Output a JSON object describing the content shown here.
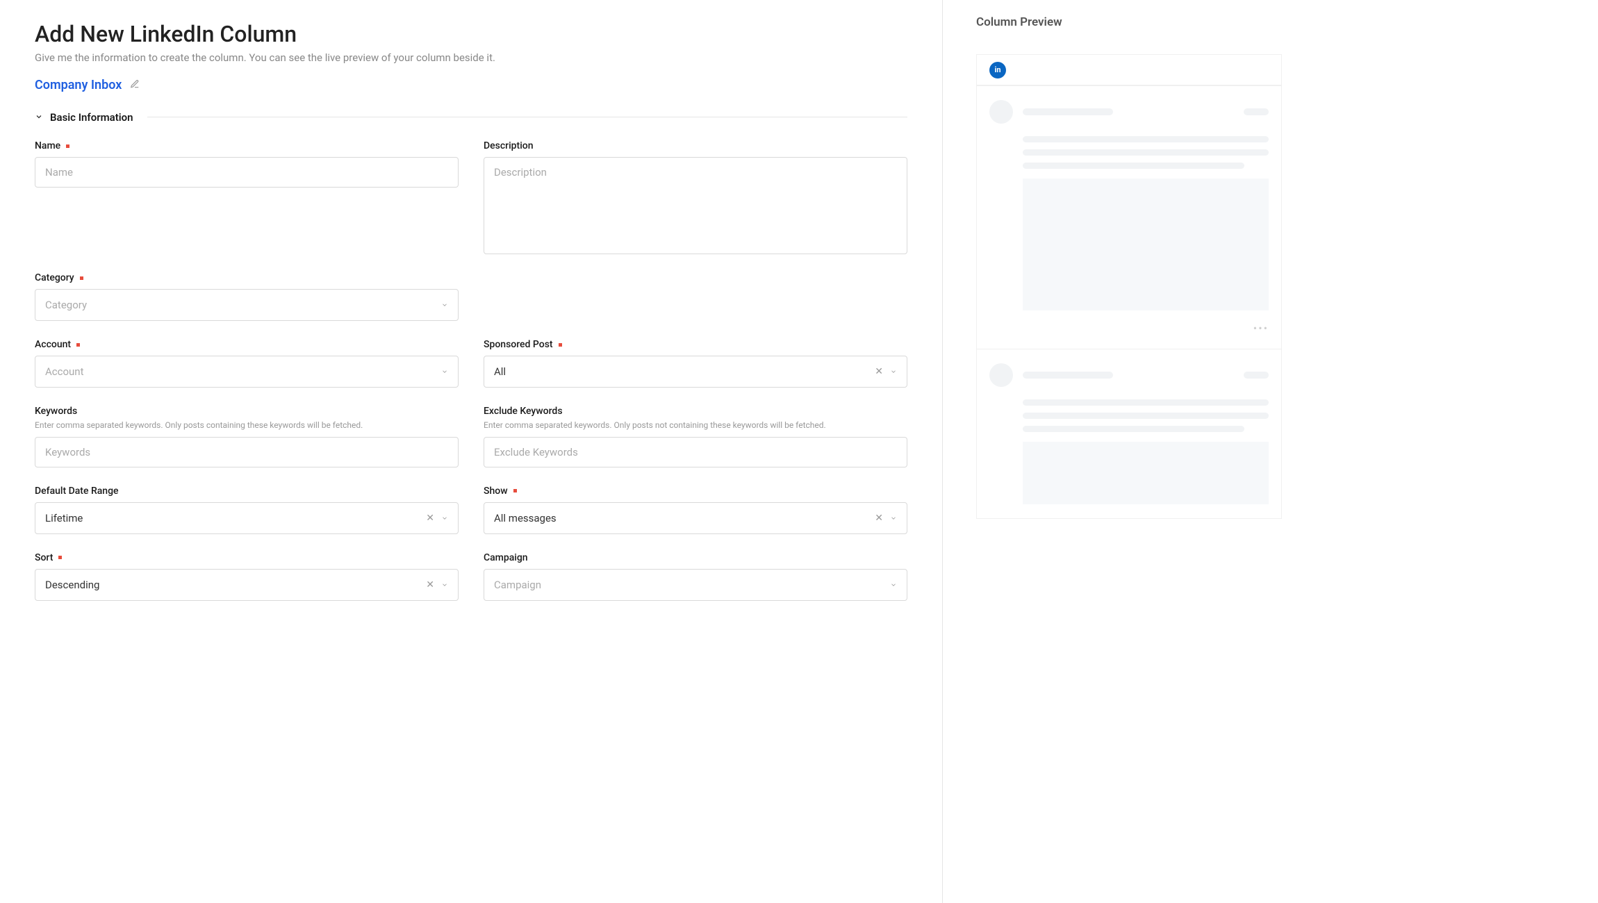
{
  "page": {
    "title": "Add New LinkedIn Column",
    "subtitle": "Give me the information to create the column. You can see the live preview of your column beside it."
  },
  "columnName": "Company Inbox",
  "section": {
    "title": "Basic Information"
  },
  "fields": {
    "name": {
      "label": "Name",
      "placeholder": "Name"
    },
    "description": {
      "label": "Description",
      "placeholder": "Description"
    },
    "category": {
      "label": "Category",
      "placeholder": "Category"
    },
    "account": {
      "label": "Account",
      "placeholder": "Account"
    },
    "sponsored": {
      "label": "Sponsored Post",
      "value": "All"
    },
    "keywords": {
      "label": "Keywords",
      "hint": "Enter comma separated keywords. Only posts containing these keywords will be fetched.",
      "placeholder": "Keywords"
    },
    "excludeKeywords": {
      "label": "Exclude Keywords",
      "hint": "Enter comma separated keywords. Only posts not containing these keywords will be fetched.",
      "placeholder": "Exclude Keywords"
    },
    "dateRange": {
      "label": "Default Date Range",
      "value": "Lifetime"
    },
    "show": {
      "label": "Show",
      "value": "All messages"
    },
    "sort": {
      "label": "Sort",
      "value": "Descending"
    },
    "campaign": {
      "label": "Campaign",
      "placeholder": "Campaign"
    }
  },
  "preview": {
    "title": "Column Preview",
    "brand": "in"
  },
  "colors": {
    "accent": "#1f5fe0",
    "linkedin": "#0a66c2",
    "required": "#e74c3c"
  }
}
